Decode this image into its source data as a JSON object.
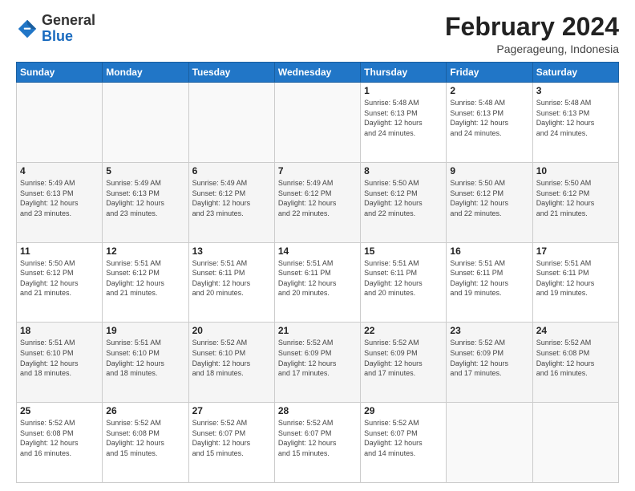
{
  "header": {
    "logo_general": "General",
    "logo_blue": "Blue",
    "month_year": "February 2024",
    "location": "Pagerageung, Indonesia"
  },
  "days_of_week": [
    "Sunday",
    "Monday",
    "Tuesday",
    "Wednesday",
    "Thursday",
    "Friday",
    "Saturday"
  ],
  "weeks": [
    [
      {
        "day": "",
        "info": ""
      },
      {
        "day": "",
        "info": ""
      },
      {
        "day": "",
        "info": ""
      },
      {
        "day": "",
        "info": ""
      },
      {
        "day": "1",
        "info": "Sunrise: 5:48 AM\nSunset: 6:13 PM\nDaylight: 12 hours\nand 24 minutes."
      },
      {
        "day": "2",
        "info": "Sunrise: 5:48 AM\nSunset: 6:13 PM\nDaylight: 12 hours\nand 24 minutes."
      },
      {
        "day": "3",
        "info": "Sunrise: 5:48 AM\nSunset: 6:13 PM\nDaylight: 12 hours\nand 24 minutes."
      }
    ],
    [
      {
        "day": "4",
        "info": "Sunrise: 5:49 AM\nSunset: 6:13 PM\nDaylight: 12 hours\nand 23 minutes."
      },
      {
        "day": "5",
        "info": "Sunrise: 5:49 AM\nSunset: 6:13 PM\nDaylight: 12 hours\nand 23 minutes."
      },
      {
        "day": "6",
        "info": "Sunrise: 5:49 AM\nSunset: 6:12 PM\nDaylight: 12 hours\nand 23 minutes."
      },
      {
        "day": "7",
        "info": "Sunrise: 5:49 AM\nSunset: 6:12 PM\nDaylight: 12 hours\nand 22 minutes."
      },
      {
        "day": "8",
        "info": "Sunrise: 5:50 AM\nSunset: 6:12 PM\nDaylight: 12 hours\nand 22 minutes."
      },
      {
        "day": "9",
        "info": "Sunrise: 5:50 AM\nSunset: 6:12 PM\nDaylight: 12 hours\nand 22 minutes."
      },
      {
        "day": "10",
        "info": "Sunrise: 5:50 AM\nSunset: 6:12 PM\nDaylight: 12 hours\nand 21 minutes."
      }
    ],
    [
      {
        "day": "11",
        "info": "Sunrise: 5:50 AM\nSunset: 6:12 PM\nDaylight: 12 hours\nand 21 minutes."
      },
      {
        "day": "12",
        "info": "Sunrise: 5:51 AM\nSunset: 6:12 PM\nDaylight: 12 hours\nand 21 minutes."
      },
      {
        "day": "13",
        "info": "Sunrise: 5:51 AM\nSunset: 6:11 PM\nDaylight: 12 hours\nand 20 minutes."
      },
      {
        "day": "14",
        "info": "Sunrise: 5:51 AM\nSunset: 6:11 PM\nDaylight: 12 hours\nand 20 minutes."
      },
      {
        "day": "15",
        "info": "Sunrise: 5:51 AM\nSunset: 6:11 PM\nDaylight: 12 hours\nand 20 minutes."
      },
      {
        "day": "16",
        "info": "Sunrise: 5:51 AM\nSunset: 6:11 PM\nDaylight: 12 hours\nand 19 minutes."
      },
      {
        "day": "17",
        "info": "Sunrise: 5:51 AM\nSunset: 6:11 PM\nDaylight: 12 hours\nand 19 minutes."
      }
    ],
    [
      {
        "day": "18",
        "info": "Sunrise: 5:51 AM\nSunset: 6:10 PM\nDaylight: 12 hours\nand 18 minutes."
      },
      {
        "day": "19",
        "info": "Sunrise: 5:51 AM\nSunset: 6:10 PM\nDaylight: 12 hours\nand 18 minutes."
      },
      {
        "day": "20",
        "info": "Sunrise: 5:52 AM\nSunset: 6:10 PM\nDaylight: 12 hours\nand 18 minutes."
      },
      {
        "day": "21",
        "info": "Sunrise: 5:52 AM\nSunset: 6:09 PM\nDaylight: 12 hours\nand 17 minutes."
      },
      {
        "day": "22",
        "info": "Sunrise: 5:52 AM\nSunset: 6:09 PM\nDaylight: 12 hours\nand 17 minutes."
      },
      {
        "day": "23",
        "info": "Sunrise: 5:52 AM\nSunset: 6:09 PM\nDaylight: 12 hours\nand 17 minutes."
      },
      {
        "day": "24",
        "info": "Sunrise: 5:52 AM\nSunset: 6:08 PM\nDaylight: 12 hours\nand 16 minutes."
      }
    ],
    [
      {
        "day": "25",
        "info": "Sunrise: 5:52 AM\nSunset: 6:08 PM\nDaylight: 12 hours\nand 16 minutes."
      },
      {
        "day": "26",
        "info": "Sunrise: 5:52 AM\nSunset: 6:08 PM\nDaylight: 12 hours\nand 15 minutes."
      },
      {
        "day": "27",
        "info": "Sunrise: 5:52 AM\nSunset: 6:07 PM\nDaylight: 12 hours\nand 15 minutes."
      },
      {
        "day": "28",
        "info": "Sunrise: 5:52 AM\nSunset: 6:07 PM\nDaylight: 12 hours\nand 15 minutes."
      },
      {
        "day": "29",
        "info": "Sunrise: 5:52 AM\nSunset: 6:07 PM\nDaylight: 12 hours\nand 14 minutes."
      },
      {
        "day": "",
        "info": ""
      },
      {
        "day": "",
        "info": ""
      }
    ]
  ]
}
